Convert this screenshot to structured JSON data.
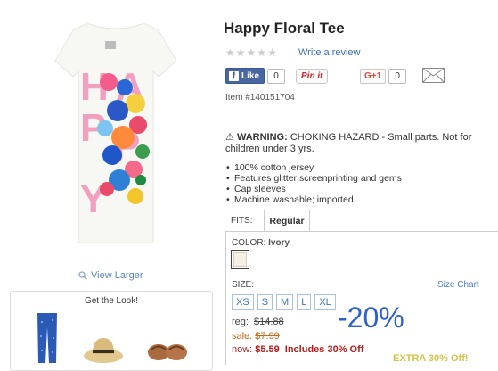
{
  "product": {
    "title": "Happy Floral Tee",
    "review_link": "Write a review",
    "item_number": "Item #140151704",
    "view_larger": "View Larger",
    "tee_letters": [
      "H",
      "A",
      "P",
      "P",
      "Y"
    ]
  },
  "social": {
    "like_label": "Like",
    "like_count": "0",
    "pin_label": "Pin it",
    "gplus_label": "G+1",
    "gplus_count": "0"
  },
  "warning": {
    "label": "WARNING:",
    "text": "CHOKING HAZARD - Small parts. Not for children under 3 yrs."
  },
  "features": [
    "100% cotton jersey",
    "Features glitter screenprinting and gems",
    "Cap sleeves",
    "Machine washable; imported"
  ],
  "fits": {
    "label": "FITS:",
    "selected": "Regular"
  },
  "color": {
    "label": "COLOR:",
    "value": "Ivory",
    "swatch_hex": "#f6f1e6"
  },
  "size": {
    "label": "SIZE:",
    "chart_link": "Size Chart",
    "options": [
      "XS",
      "S",
      "M",
      "L",
      "XL"
    ]
  },
  "pricing": {
    "reg_label": "reg:",
    "reg_value": "$14.88",
    "sale_label": "sale:",
    "sale_value": "$7.99",
    "now_label": "now:",
    "now_value": "$5.59",
    "includes_text": "Includes 30% Off",
    "discount_badge": "-20%",
    "extra_text": "EXTRA 30% Off!"
  },
  "get_the_look": {
    "title": "Get the Look!"
  },
  "colors": {
    "link": "#3b6ea5",
    "discount": "#2a5fcf",
    "now_price": "#b71c1c",
    "sale_price": "#c8691a",
    "size_button": "#3d72b4"
  }
}
